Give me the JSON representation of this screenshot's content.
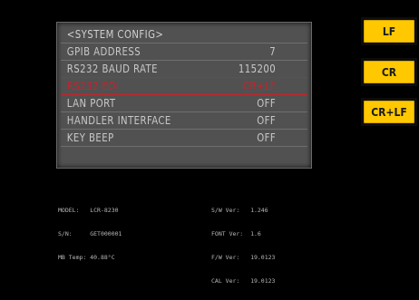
{
  "menu": {
    "title": "<SYSTEM CONFIG>",
    "rows": [
      {
        "label": "GPIB ADDRESS",
        "value": "7"
      },
      {
        "label": "RS232 BAUD RATE",
        "value": "115200"
      },
      {
        "label": "RS232 EOI",
        "value": "CR+LF"
      },
      {
        "label": "LAN PORT",
        "value": "OFF"
      },
      {
        "label": "HANDLER INTERFACE",
        "value": "OFF"
      },
      {
        "label": "KEY BEEP",
        "value": "OFF"
      }
    ],
    "selected_index": 2
  },
  "info": {
    "model_label": "MODEL:",
    "model_value": "LCR-8230",
    "sn_label": "S/N:",
    "sn_value": "GET000001",
    "mb_temp_label": "MB Temp:",
    "mb_temp_value": "40.88°C",
    "sw_ver_label": "S/W Ver:",
    "sw_ver_value": "1.246",
    "font_ver_label": "FONT Ver:",
    "font_ver_value": "1.6",
    "fw_ver_label": "F/W Ver:",
    "fw_ver_value": "19.0123",
    "cal_ver_label": "CAL Ver:",
    "cal_ver_value": "19.0123"
  },
  "softkeys": [
    {
      "label": "LF"
    },
    {
      "label": "CR"
    },
    {
      "label": "CR+LF"
    }
  ],
  "colors": {
    "panel_bg": "#515151",
    "selected_text": "#c8222a",
    "softkey_bg": "#ffc800"
  }
}
